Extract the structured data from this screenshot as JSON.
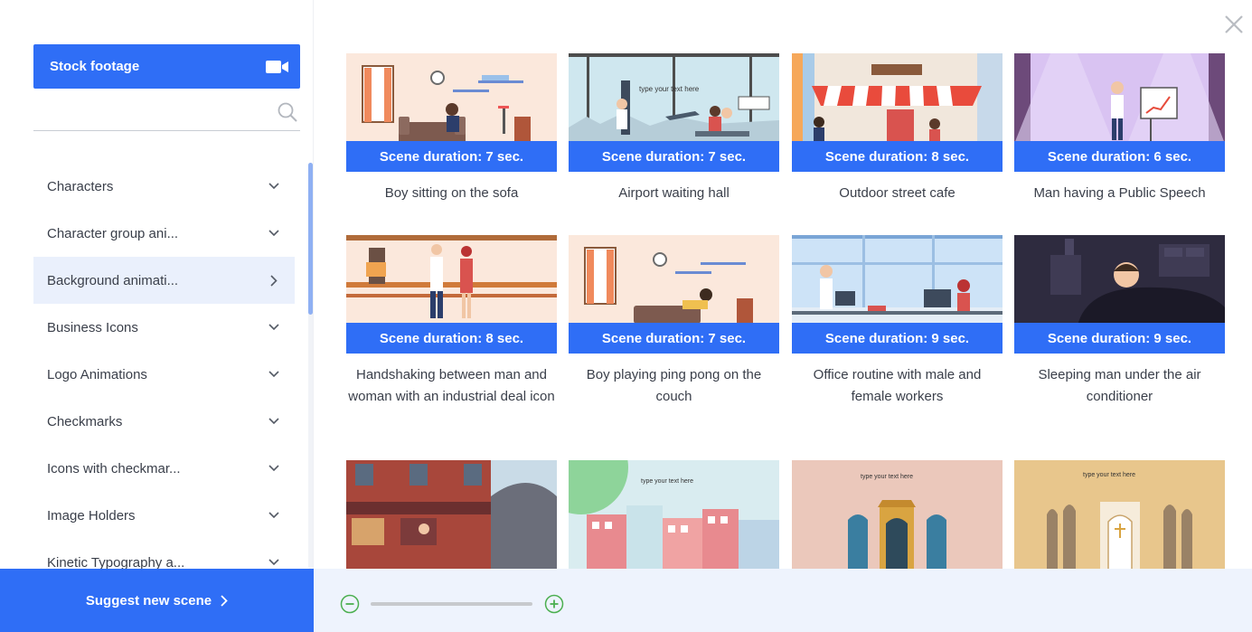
{
  "sidebar": {
    "stock_button_label": "Stock footage",
    "search_placeholder": "",
    "categories": [
      {
        "label": "Characters",
        "icon": "chevron-down-icon"
      },
      {
        "label": "Character group ani...",
        "icon": "chevron-down-icon"
      },
      {
        "label": "Background animati...",
        "icon": "chevron-right-icon",
        "active": true
      },
      {
        "label": "Business Icons",
        "icon": "chevron-down-icon"
      },
      {
        "label": "Logo Animations",
        "icon": "chevron-down-icon"
      },
      {
        "label": "Checkmarks",
        "icon": "chevron-down-icon"
      },
      {
        "label": "Icons with checkmar...",
        "icon": "chevron-down-icon"
      },
      {
        "label": "Image Holders",
        "icon": "chevron-down-icon"
      },
      {
        "label": "Kinetic Typography a...",
        "icon": "chevron-down-icon"
      }
    ],
    "suggest_label": "Suggest new scene"
  },
  "scenes": [
    {
      "duration": "Scene duration: 7 sec.",
      "title": "Boy sitting on the sofa"
    },
    {
      "duration": "Scene duration: 7 sec.",
      "title": "Airport waiting hall",
      "thumb_text": "type your text here"
    },
    {
      "duration": "Scene duration: 8 sec.",
      "title": "Outdoor street cafe"
    },
    {
      "duration": "Scene duration: 6 sec.",
      "title": "Man having a Public Speech"
    },
    {
      "duration": "Scene duration: 8 sec.",
      "title": "Handshaking between man and woman with an industrial deal icon"
    },
    {
      "duration": "Scene duration: 7 sec.",
      "title": "Boy playing ping pong on the couch"
    },
    {
      "duration": "Scene duration: 9 sec.",
      "title": "Office routine with male and female workers"
    },
    {
      "duration": "Scene duration: 9 sec.",
      "title": "Sleeping man under the air conditioner"
    },
    {
      "duration": "",
      "title": ""
    },
    {
      "duration": "",
      "title": "",
      "thumb_text": "type your text here"
    },
    {
      "duration": "",
      "title": "",
      "thumb_text": "type your text here"
    },
    {
      "duration": "",
      "title": "",
      "thumb_text": "type your text here"
    }
  ],
  "colors": {
    "accent": "#2f6ef6",
    "zoom_bar_bg": "#eef3fd",
    "active_category_bg": "#eaf0fc",
    "zoom_icon": "#4caf50"
  },
  "icons": {
    "stock": "video-camera-icon",
    "search": "search-icon",
    "close": "close-icon",
    "suggest": "chevron-right-icon",
    "zoom_out": "zoom-out-icon",
    "zoom_in": "zoom-in-icon"
  }
}
